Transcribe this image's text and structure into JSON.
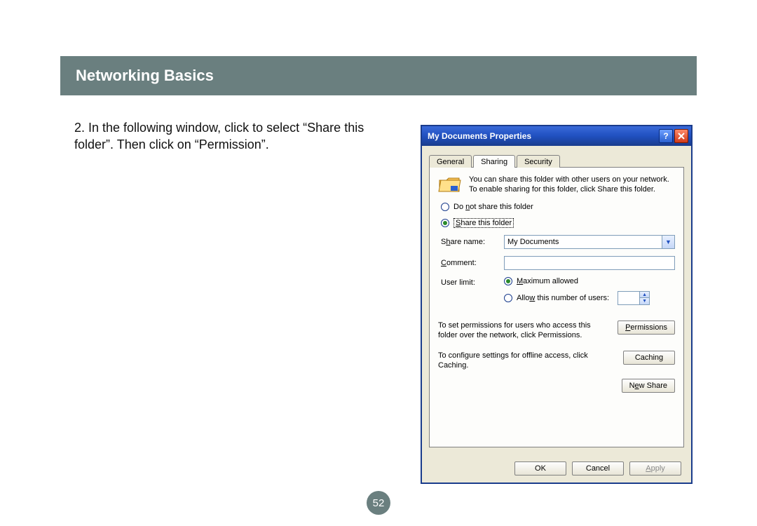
{
  "page": {
    "header": "Networking Basics",
    "instruction": "2. In the following window, click to select “Share this folder”. Then click on “Permission”.",
    "page_number": "52"
  },
  "dialog": {
    "title": "My Documents Properties",
    "tabs": {
      "general": "General",
      "sharing": "Sharing",
      "security": "Security"
    },
    "desc": "You can share this folder with other users on your network.  To enable sharing for this folder, click Share this folder.",
    "radio_no_pre": "Do ",
    "radio_no_u": "n",
    "radio_no_post": "ot share this folder",
    "radio_share_u": "S",
    "radio_share_post": "hare this folder",
    "share_name_pre": "S",
    "share_name_u": "h",
    "share_name_post": "are name:",
    "share_name_value": "My Documents",
    "comment_u": "C",
    "comment_post": "omment:",
    "comment_value": "",
    "user_limit_label": "User limit:",
    "max_u": "M",
    "max_post": "aximum allowed",
    "allow_pre": "Allo",
    "allow_u": "w",
    "allow_post": " this number of users:",
    "perm_text": "To set permissions for users who access this folder over the network, click Permissions.",
    "perm_u": "P",
    "perm_btn_post": "ermissions",
    "cache_text": "To configure settings for offline access, click Caching.",
    "cache_btn": "Caching",
    "new_share_pre": "N",
    "new_share_u": "e",
    "new_share_post": "w Share",
    "ok": "OK",
    "cancel": "Cancel",
    "apply_u": "A",
    "apply_post": "pply"
  }
}
